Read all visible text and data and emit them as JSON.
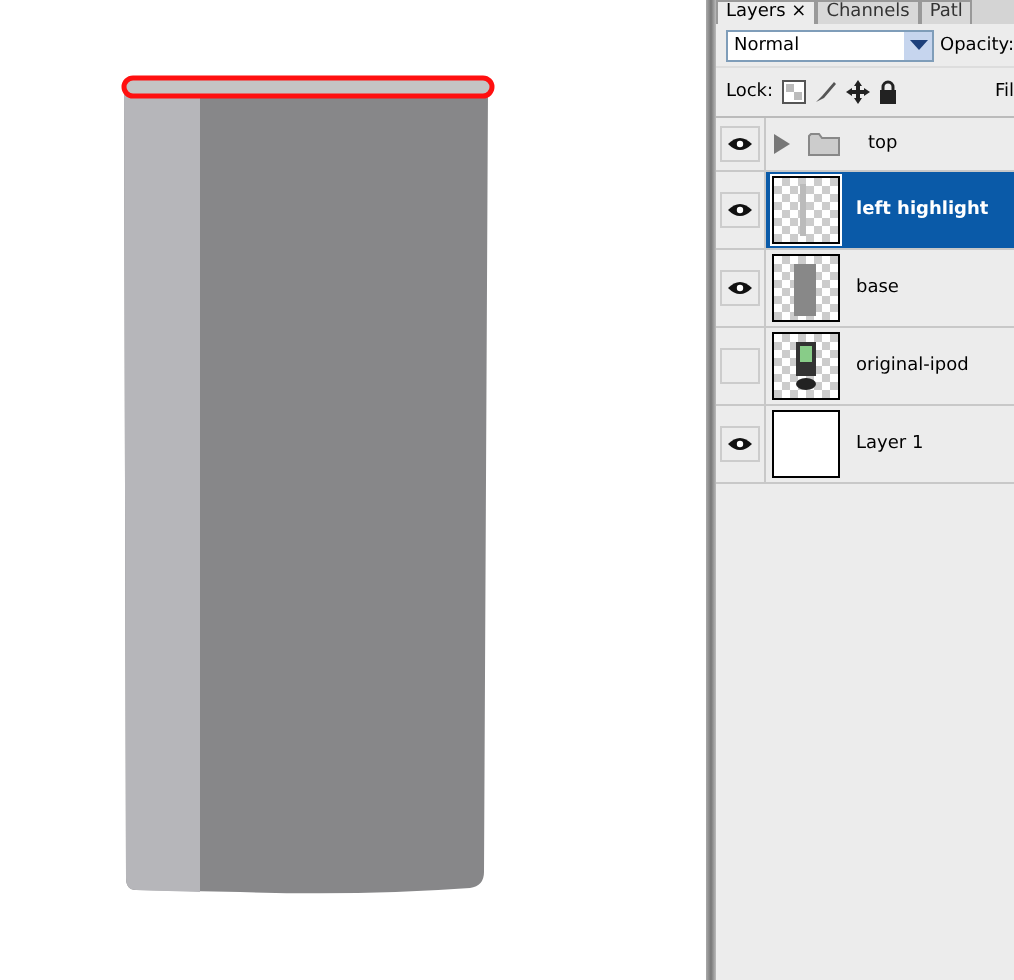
{
  "tabs": [
    {
      "label": "Layers ×",
      "selected": true
    },
    {
      "label": "Channels",
      "selected": false
    },
    {
      "label": "Patl",
      "selected": false
    }
  ],
  "blend_mode": "Normal",
  "opacity_label": "Opacity:",
  "lock_label": "Lock:",
  "fill_label": "Fil",
  "layers": [
    {
      "kind": "group",
      "name": "top",
      "visible": true,
      "selected": false,
      "expanded": false
    },
    {
      "kind": "highlight",
      "name": "left highlight",
      "visible": true,
      "selected": true
    },
    {
      "kind": "base",
      "name": "base",
      "visible": true,
      "selected": false
    },
    {
      "kind": "photo",
      "name": "original-ipod",
      "visible": false,
      "selected": false
    },
    {
      "kind": "blank",
      "name": "Layer 1",
      "visible": true,
      "selected": false
    }
  ]
}
